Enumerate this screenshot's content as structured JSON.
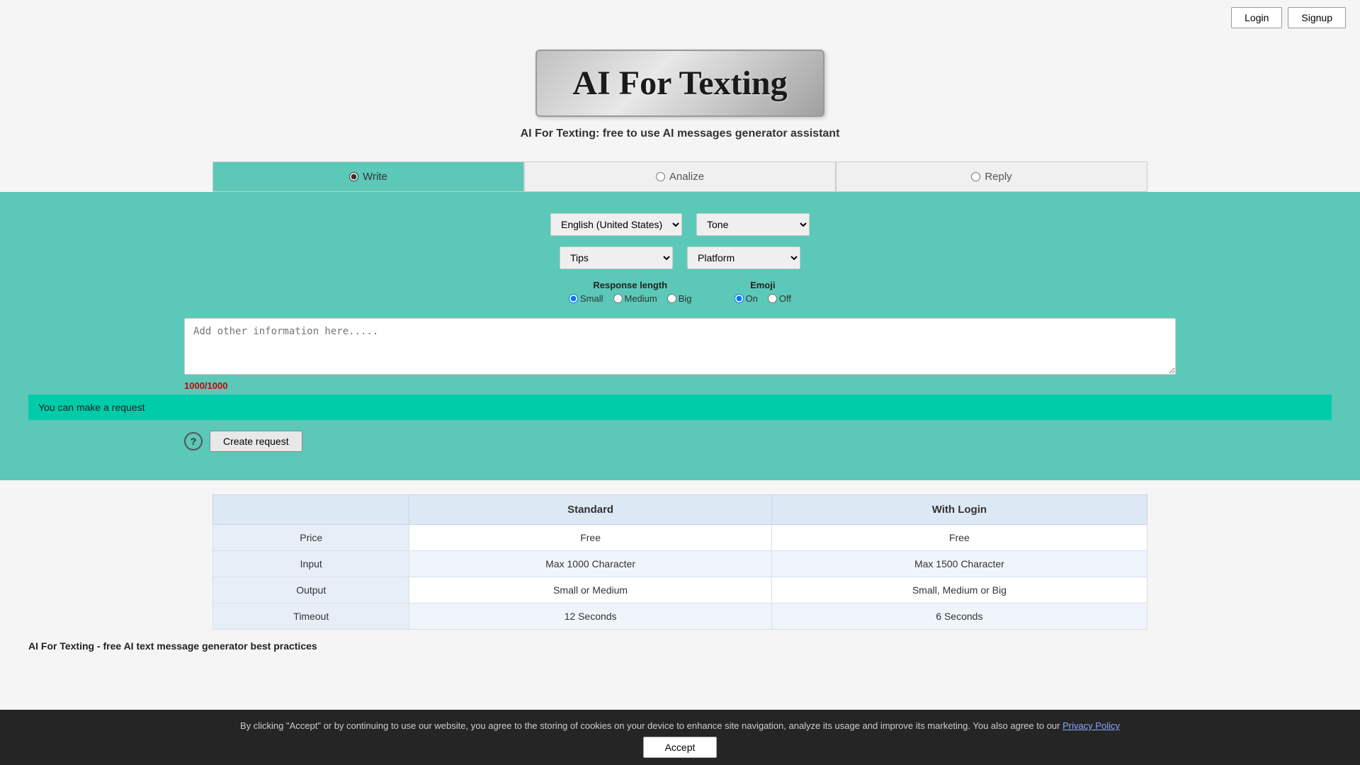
{
  "header": {
    "login_label": "Login",
    "signup_label": "Signup"
  },
  "logo": {
    "title": "AI For Texting",
    "subtitle": "AI For Texting: free to use AI messages generator assistant"
  },
  "tabs": [
    {
      "id": "write",
      "label": "Write",
      "active": true
    },
    {
      "id": "analize",
      "label": "Analize",
      "active": false
    },
    {
      "id": "reply",
      "label": "Reply",
      "active": false
    }
  ],
  "controls": {
    "language_default": "English (United States)",
    "tone_default": "Tone",
    "category_default": "Tips",
    "platform_default": "Platform"
  },
  "response_length": {
    "label": "Response length",
    "options": [
      "Small",
      "Medium",
      "Big"
    ],
    "selected": "Small"
  },
  "emoji": {
    "label": "Emoji",
    "options": [
      "On",
      "Off"
    ],
    "selected": "On"
  },
  "textarea": {
    "placeholder": "Add other information here.....",
    "char_count": "1000/1000"
  },
  "info_bar": {
    "message": "You can make a request"
  },
  "actions": {
    "help_label": "?",
    "create_label": "Create request"
  },
  "pricing": {
    "col_feature": "",
    "col_standard": "Standard",
    "col_with_login": "With Login",
    "rows": [
      {
        "feature": "Price",
        "standard": "Free",
        "with_login": "Free"
      },
      {
        "feature": "Input",
        "standard": "Max 1000 Character",
        "with_login": "Max 1500 Character"
      },
      {
        "feature": "Output",
        "standard": "Small or Medium",
        "with_login": "Small, Medium or Big"
      },
      {
        "feature": "Timeout",
        "standard": "12 Seconds",
        "with_login": "6 Seconds"
      }
    ]
  },
  "best_practices": {
    "label": "AI For Texting - free AI text message generator best practices"
  },
  "cookie": {
    "message": "By clicking \"Accept\" or by continuing to use our website, you agree to the storing of cookies on your device to enhance site navigation, analyze its usage and improve its marketing. You also agree to our",
    "privacy_link": "Privacy Policy",
    "accept_label": "Accept"
  },
  "colors": {
    "teal_bg": "#5bc8b8",
    "teal_bright": "#00ccaa",
    "tab_active": "#5bc8b8",
    "logo_gradient_start": "#c0c0c0",
    "logo_gradient_end": "#a0a0a0",
    "table_header_bg": "#dde8f5",
    "char_count_color": "#cc0000"
  }
}
